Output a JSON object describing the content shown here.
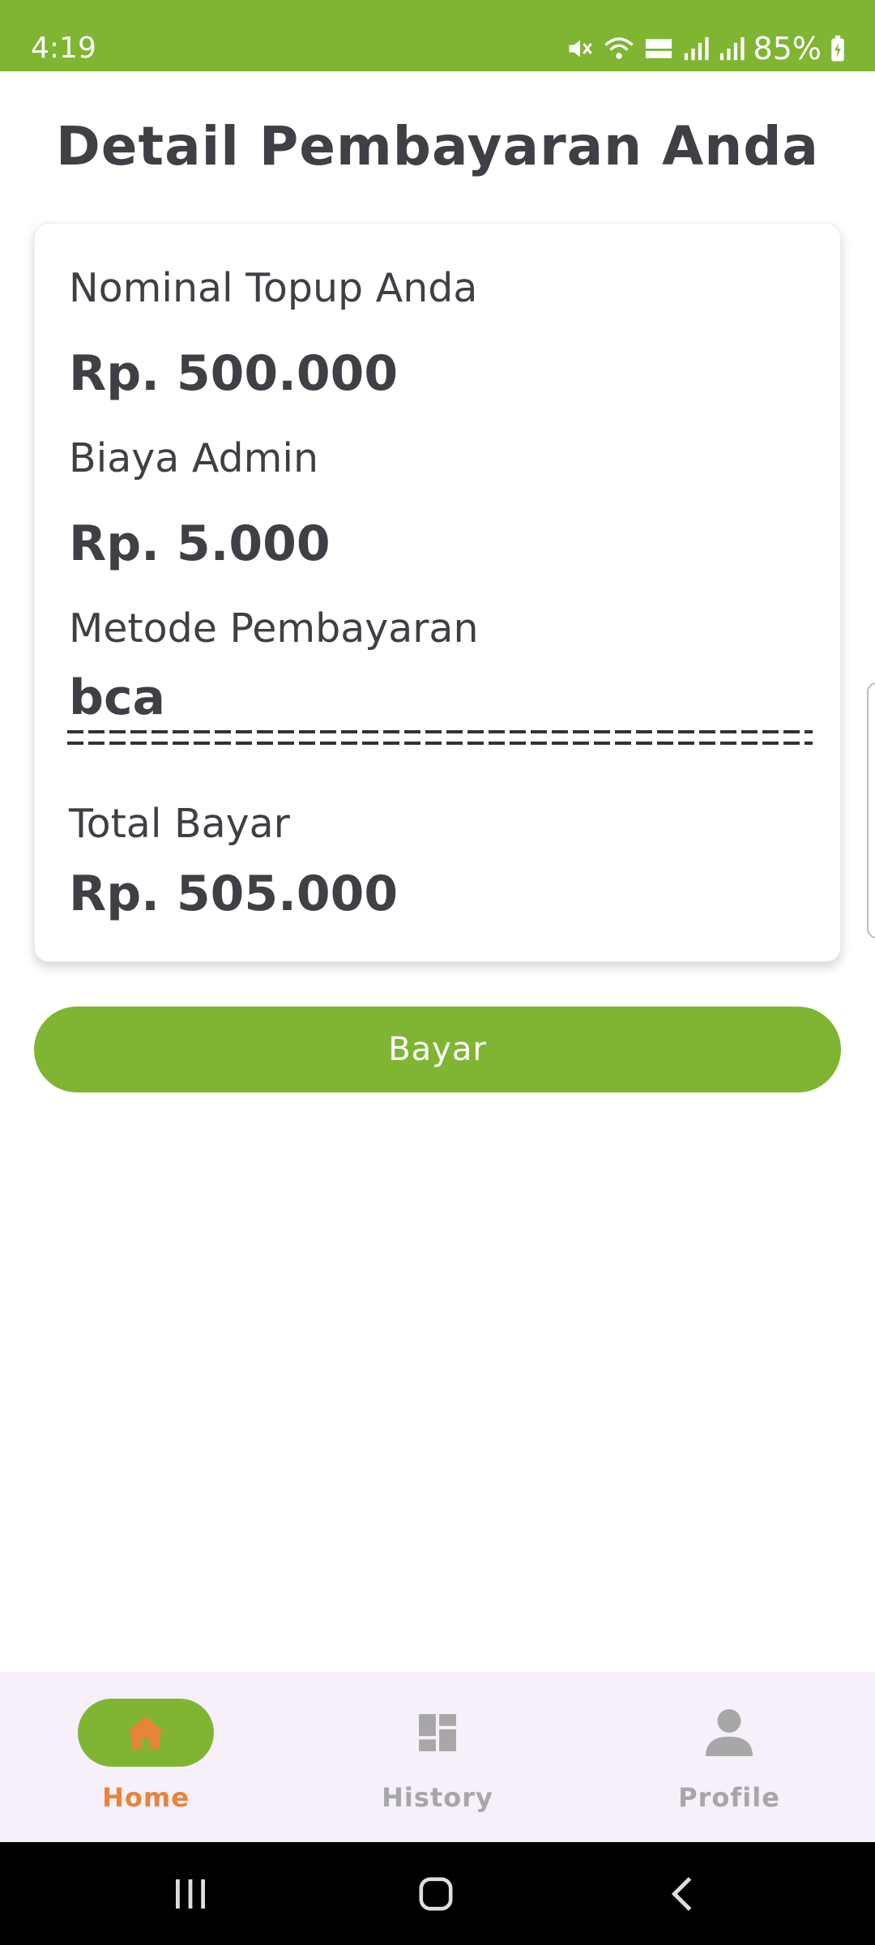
{
  "status_bar": {
    "time": "4:19",
    "battery": "85%",
    "bg_color": "#80b534"
  },
  "page": {
    "title": "Detail Pembayaran Anda"
  },
  "card": {
    "topup_label": "Nominal Topup Anda",
    "topup_value": "Rp. 500.000",
    "admin_label": "Biaya Admin",
    "admin_value": "Rp. 5.000",
    "method_label": "Metode Pembayaran",
    "method_value": "bca",
    "total_label": "Total Bayar",
    "total_value": "Rp. 505.000"
  },
  "actions": {
    "pay_label": "Bayar",
    "accent_color": "#80b534"
  },
  "bottom_nav": {
    "items": [
      {
        "label": "Home",
        "icon": "home-icon",
        "active": true
      },
      {
        "label": "History",
        "icon": "dashboard-icon",
        "active": false
      },
      {
        "label": "Profile",
        "icon": "person-icon",
        "active": false
      }
    ],
    "active_color": "#e8843a"
  },
  "system_nav": {
    "icons": [
      "recents-icon",
      "home-circle-icon",
      "back-icon"
    ]
  }
}
